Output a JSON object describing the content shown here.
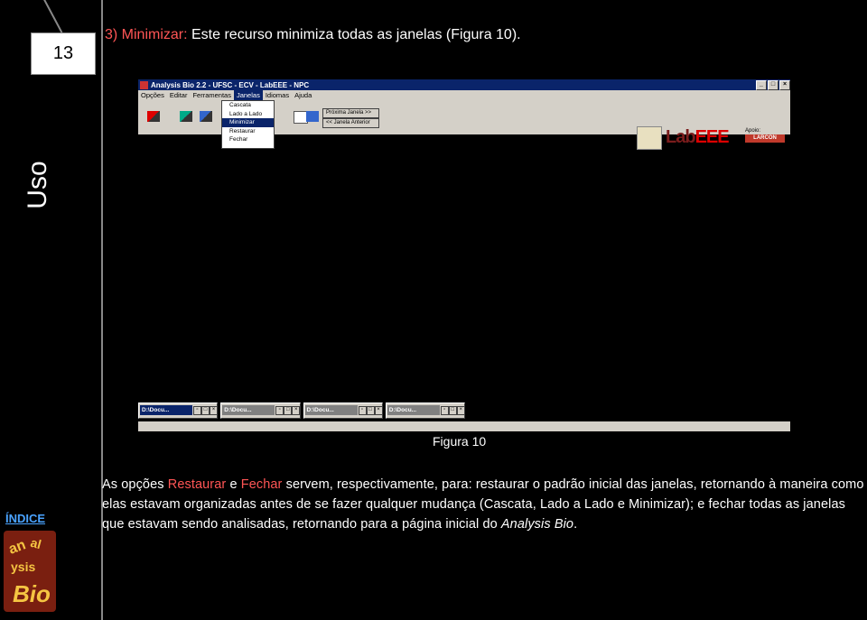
{
  "slide": {
    "page_number": "13",
    "side_label": "Uso",
    "heading_prefix": "3) Minimizar:",
    "heading_rest": " Este recurso minimiza todas as janelas (Figura 10).",
    "caption": "Figura 10",
    "index_link": "ÍNDICE",
    "logo_text": "analysis Bio"
  },
  "app": {
    "title": "Analysis Bio 2.2 - UFSC - ECV - LabEEE - NPC",
    "menu": [
      "Opções",
      "Editar",
      "Ferramentas",
      "Janelas",
      "Idiomas",
      "Ajuda"
    ],
    "active_menu_index": 3,
    "janelas_menu": [
      "Cascata",
      "Lado a Lado",
      "Minimizar",
      "Restaurar",
      "Fechar"
    ],
    "selected_item_index": 2,
    "nav_buttons": [
      "Próxima Janela >>",
      "<< Janela Anterior"
    ],
    "lab_logo": {
      "lab": "Lab",
      "eee": "EEE"
    },
    "apoio_label": "Apoio:",
    "larcon_label": "LARCON",
    "minimized_windows": [
      "D:\\Docu...",
      "D:\\Docu...",
      "D:\\Docu...",
      "D:\\Docu..."
    ],
    "colors": {
      "title_bar": "#0a246a",
      "face": "#d4d0c8",
      "highlight": "#ff5555"
    }
  },
  "paragraph": {
    "p1": "As opções ",
    "restaurar": "Restaurar",
    "p2": " e ",
    "fechar": "Fechar",
    "p3": " servem, respectivamente, para: restaurar o padrão inicial das janelas, retornando à maneira como elas estavam organizadas antes de se fazer qualquer mudança (Cascata, Lado a Lado e Minimizar); e fechar todas as janelas que estavam sendo analisadas, retornando para a página inicial do ",
    "app_name": "Analysis Bio",
    "p4": "."
  }
}
